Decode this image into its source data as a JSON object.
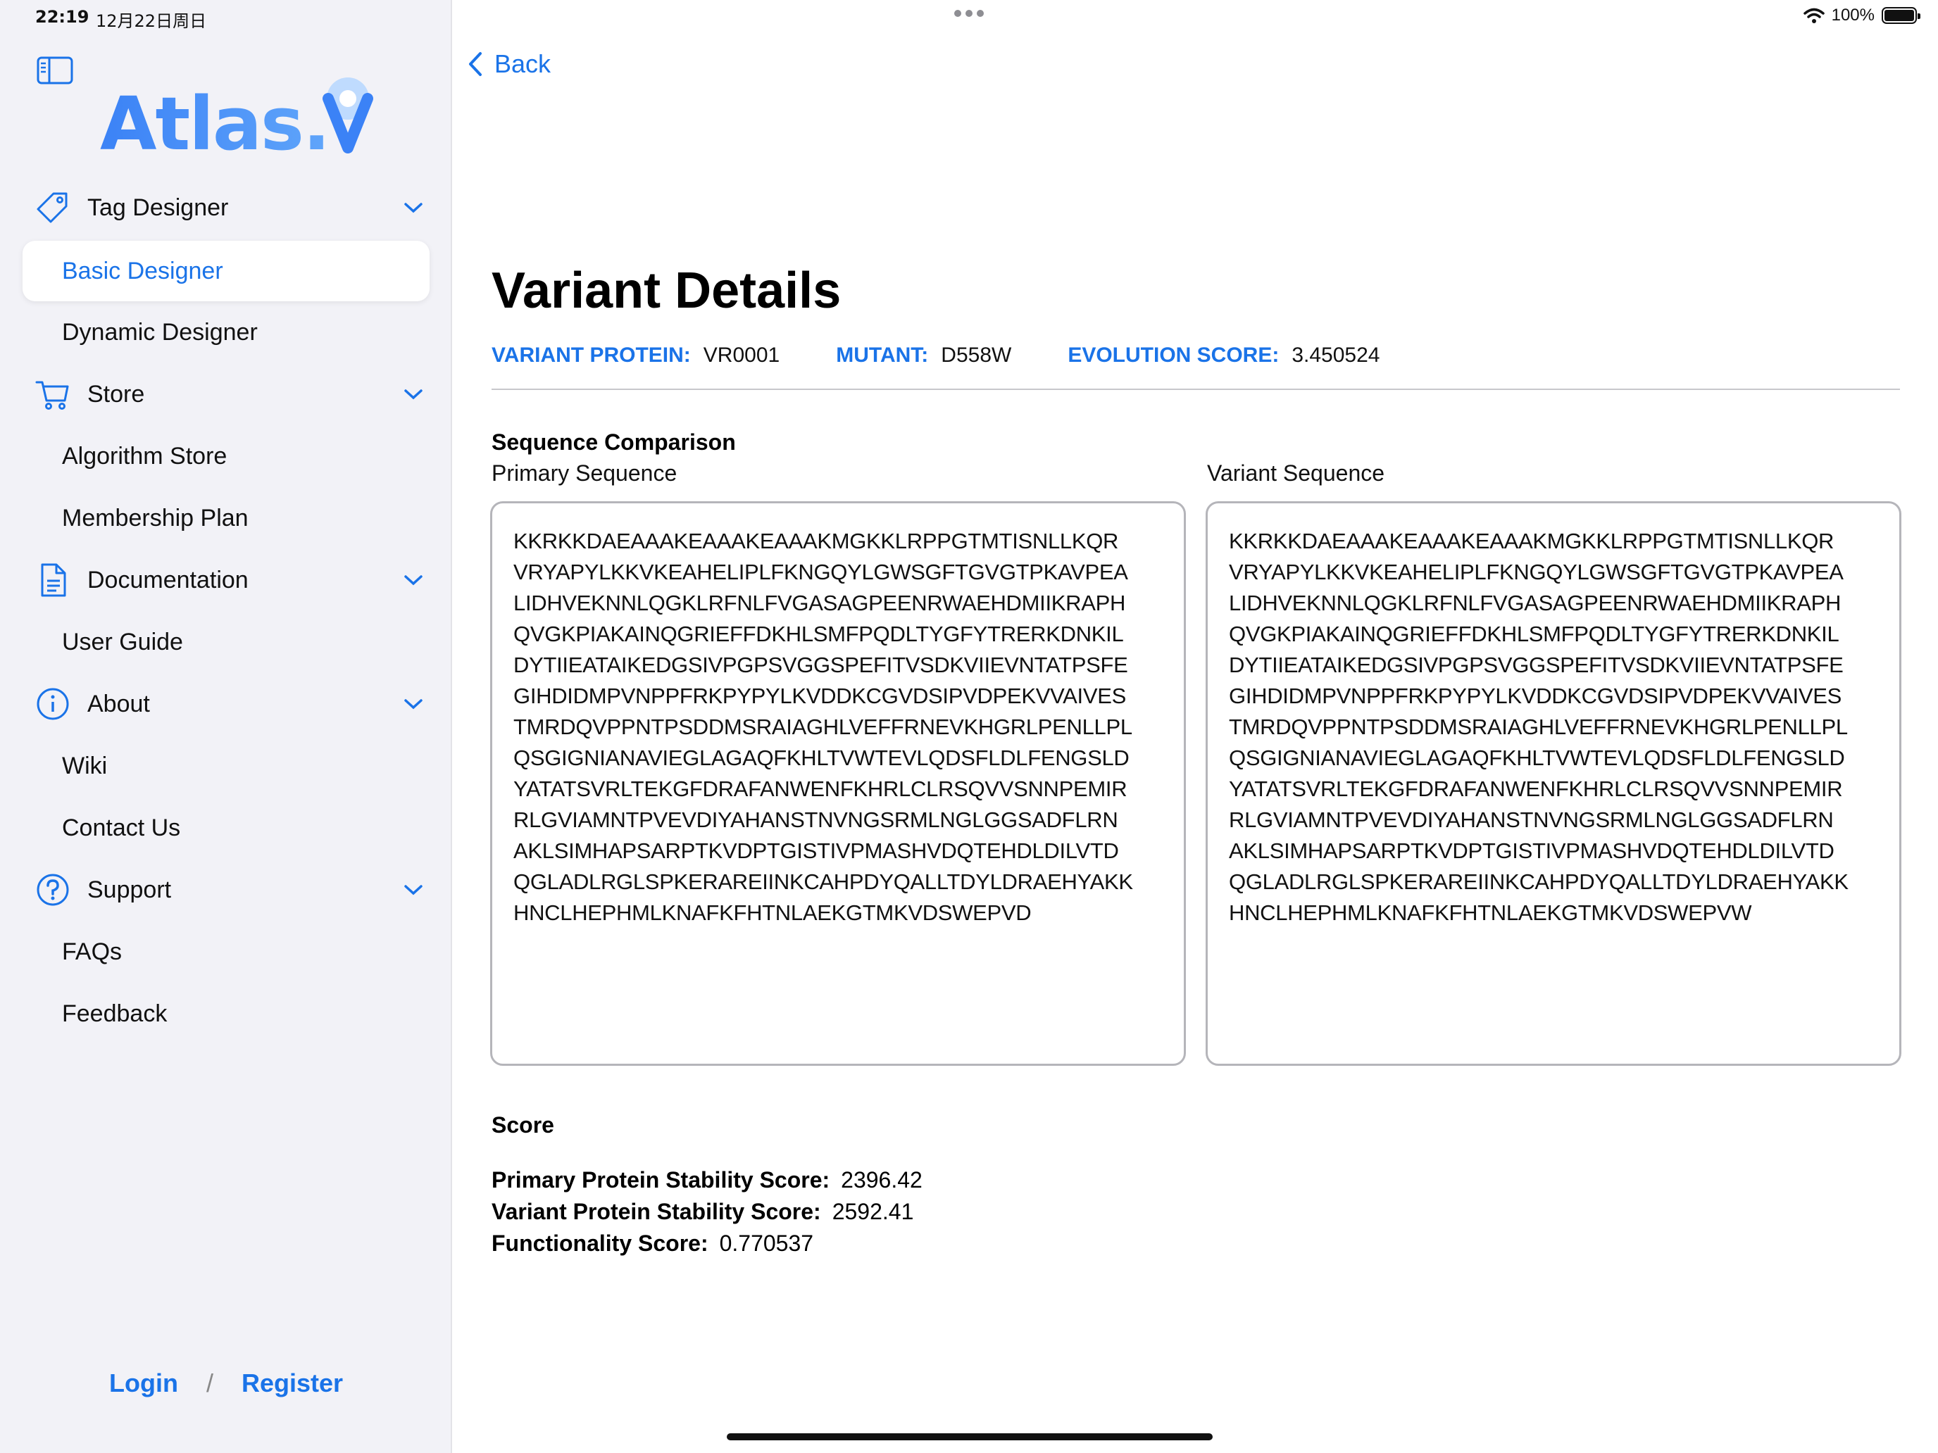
{
  "status": {
    "time": "22:19",
    "date": "12月22日周日",
    "battery": "100%"
  },
  "colors": {
    "accent": "#1a73e8",
    "sidebar_bg": "#f2f2f7"
  },
  "sidebar": {
    "logo_text": "Atlas.",
    "sections": [
      {
        "label": "Tag Designer",
        "icon": "tag-icon",
        "items": [
          "Basic Designer",
          "Dynamic Designer"
        ]
      },
      {
        "label": "Store",
        "icon": "cart-icon",
        "items": [
          "Algorithm Store",
          "Membership Plan"
        ]
      },
      {
        "label": "Documentation",
        "icon": "document-icon",
        "items": [
          "User Guide"
        ]
      },
      {
        "label": "About",
        "icon": "info-icon",
        "items": [
          "Wiki",
          "Contact Us"
        ]
      },
      {
        "label": "Support",
        "icon": "question-icon",
        "items": [
          "FAQs",
          "Feedback"
        ]
      }
    ],
    "active_item": "Basic Designer",
    "login": "Login",
    "separator": "/",
    "register": "Register"
  },
  "main": {
    "back_label": "Back",
    "title": "Variant Details",
    "meta": {
      "variant_protein_label": "VARIANT PROTEIN:",
      "variant_protein_value": "VR0001",
      "mutant_label": "MUTANT:",
      "mutant_value": "D558W",
      "evolution_score_label": "EVOLUTION SCORE:",
      "evolution_score_value": "3.450524"
    },
    "sequence_comparison_title": "Sequence Comparison",
    "primary_label": "Primary Sequence",
    "variant_label": "Variant Sequence",
    "primary_lines": [
      "KKRKKDAEAAAKEAAAKEAAAKMGKKLRPPGTMTISNLLKQR",
      "VRYAPYLKKVKEAHELIPLFKNGQYLGWSGFTGVGTPKAVPEA",
      "LIDHVEKNNLQGKLRFNLFVGASAGPEENRWAEHDMIIKRAPH",
      "QVGKPIAKAINQGRIEFFDKHLSMFPQDLTYGFYTRERKDNKIL",
      "DYTIIEATAIKEDGSIVPGPSVGGSPEFITVSDKVIIEVNTATPSFE",
      "GIHDIDMPVNPPFRKPYPYLKVDDKCGVDSIPVDPEKVVAIVES",
      "TMRDQVPPNTPSDDMSRAIAGHLVEFFRNEVKHGRLPENLLPL",
      "QSGIGNIANAVIEGLAGAQFKHLTVWTEVLQDSFLDLFENGSLD",
      "YATATSVRLTEKGFDRAFANWENFKHRLCLRSQVVSNNPEMIR",
      "RLGVIAMNTPVEVDIYAHANSTNVNGSRMLNGLGGSADFLRN",
      "AKLSIMHAPSARPTKVDPTGISTIVPMASHVDQTEHDLDILVTD",
      "QGLADLRGLSPKERAREIINKCAHPDYQALLTDYLDRAEHYAKK",
      "HNCLHEPHMLKNAFKFHTNLAEKGTMKVDSWEPVD"
    ],
    "variant_lines": [
      "KKRKKDAEAAAKEAAAKEAAAKMGKKLRPPGTMTISNLLKQR",
      "VRYAPYLKKVKEAHELIPLFKNGQYLGWSGFTGVGTPKAVPEA",
      "LIDHVEKNNLQGKLRFNLFVGASAGPEENRWAEHDMIIKRAPH",
      "QVGKPIAKAINQGRIEFFDKHLSMFPQDLTYGFYTRERKDNKIL",
      "DYTIIEATAIKEDGSIVPGPSVGGSPEFITVSDKVIIEVNTATPSFE",
      "GIHDIDMPVNPPFRKPYPYLKVDDKCGVDSIPVDPEKVVAIVES",
      "TMRDQVPPNTPSDDMSRAIAGHLVEFFRNEVKHGRLPENLLPL",
      "QSGIGNIANAVIEGLAGAQFKHLTVWTEVLQDSFLDLFENGSLD",
      "YATATSVRLTEKGFDRAFANWENFKHRLCLRSQVVSNNPEMIR",
      "RLGVIAMNTPVEVDIYAHANSTNVNGSRMLNGLGGSADFLRN",
      "AKLSIMHAPSARPTKVDPTGISTIVPMASHVDQTEHDLDILVTD",
      "QGLADLRGLSPKERAREIINKCAHPDYQALLTDYLDRAEHYAKK",
      "HNCLHEPHMLKNAFKFHTNLAEKGTMKVDSWEPVW"
    ],
    "score_title": "Score",
    "scores": [
      {
        "label": "Primary Protein Stability Score:",
        "value": "2396.42"
      },
      {
        "label": "Variant Protein Stability Score:",
        "value": "2592.41"
      },
      {
        "label": "Functionality Score:",
        "value": "0.770537"
      }
    ]
  }
}
